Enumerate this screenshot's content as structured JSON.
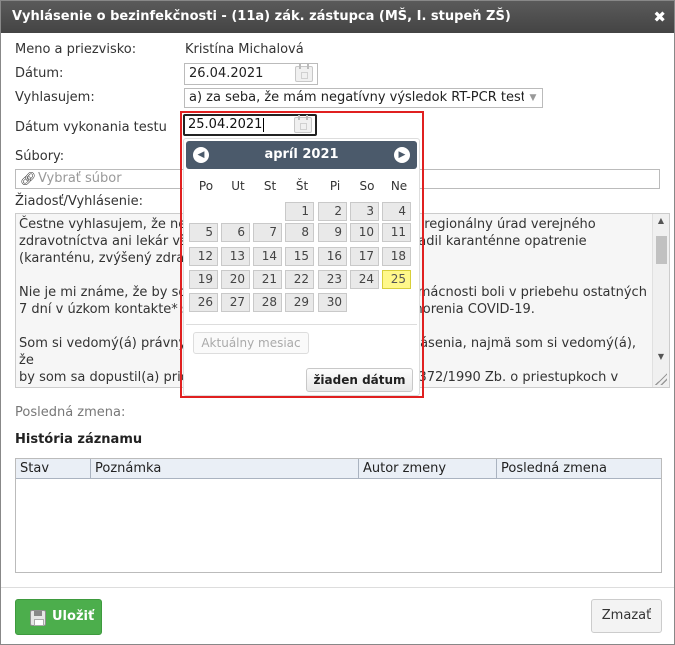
{
  "dialog": {
    "title": "Vyhlásenie o bezinfekčnosti - (11a) zák. zástupca (MŠ, I. stupeň ZŠ)",
    "close": "✖"
  },
  "form": {
    "name_label": "Meno a priezvisko:",
    "name_value": "Kristína Michalová",
    "date_label": "Dátum:",
    "date_value": "26.04.2021",
    "declare_label": "Vyhlasujem:",
    "declare_value": "a) za seba, že mám negatívny výsledok RT-PCR testu…",
    "test_date_label": "Dátum vykonania testu",
    "test_date_value": "25.04.2021",
    "files_label": "Súbory:",
    "files_placeholder": "Vybrať súbor",
    "request_label": "Žiadosť/Vyhlásenie:",
    "request_text": "Čestne vyhlasujem, že nep                                                   že regionálny úrad verejného\nzdravotníctva ani lekár všeo                                                  riadil karanténne opatrenie\n(karanténu, zvýšený zdravo\n\nNie je mi známe, že by som                                                   omácnosti boli v priebehu ostatných\n7 dní v úzkom kontakte* s o                                                  chorenia COVID-19.\n\nSom si vedomý(á) právnych                                                    lásenia, najmä som si vedomý(á), že\nby som sa dopustil(a) priest                                                 č. 372/1990 Zb. o priestupkoch v\nznení neskorších predpisov\nZároveň svojím podpisom n                                                    a školskému zariadeniu, ako aj jej\nzriaďovateľovi a Ministerstv                                                nskej republiky dobrovoľne súhlas",
    "last_change_label": "Posledná zmena:",
    "history_title": "História záznamu",
    "history_columns": [
      "Stav",
      "Poznámka",
      "Autor zmeny",
      "Posledná zmena"
    ]
  },
  "footer": {
    "save_label": "Uložiť",
    "delete_label": "Zmazať"
  },
  "datepicker": {
    "month_label": "apríl 2021",
    "prev": "◀",
    "next": "▶",
    "weekdays": [
      "Po",
      "Ut",
      "St",
      "Št",
      "Pi",
      "So",
      "Ne"
    ],
    "weeks": [
      [
        "",
        "",
        "",
        "1",
        "2",
        "3",
        "4"
      ],
      [
        "5",
        "6",
        "7",
        "8",
        "9",
        "10",
        "11"
      ],
      [
        "12",
        "13",
        "14",
        "15",
        "16",
        "17",
        "18"
      ],
      [
        "19",
        "20",
        "21",
        "22",
        "23",
        "24",
        "25"
      ],
      [
        "26",
        "27",
        "28",
        "29",
        "30",
        "",
        ""
      ]
    ],
    "selected_day": "25",
    "current_month_label": "Aktuálny mesiac",
    "no_date_label": "žiaden dátum"
  },
  "colors": {
    "titlebar": "#4a4a4a",
    "accent_green": "#4cae4c",
    "highlight_red": "#e02020",
    "today_yellow": "#fff88a"
  }
}
